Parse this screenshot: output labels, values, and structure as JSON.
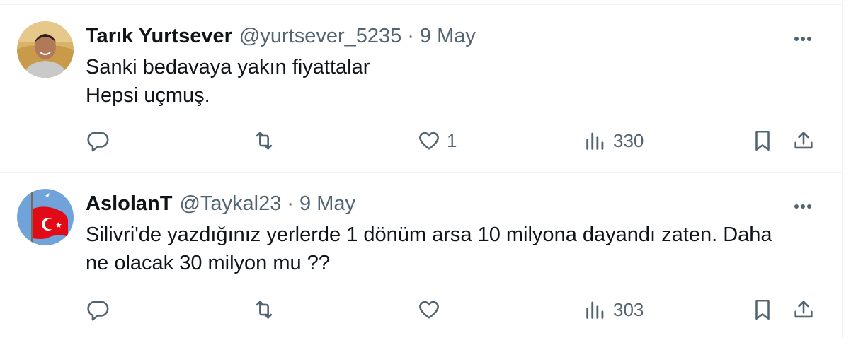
{
  "tweets": [
    {
      "author": {
        "name": "Tarık Yurtsever",
        "handle": "@yurtsever_5235",
        "avatar_icon": "avatar-person-photo"
      },
      "separator": "·",
      "date": "9 May",
      "text_lines": [
        "Sanki bedavaya yakın fiyattalar",
        "Hepsi uçmuş."
      ],
      "stats": {
        "replies": "",
        "retweets": "",
        "likes": "1",
        "views": "330"
      }
    },
    {
      "author": {
        "name": "AslolanT",
        "handle": "@Taykal23",
        "avatar_icon": "avatar-turkish-flag"
      },
      "separator": "·",
      "date": "9 May",
      "text_lines": [
        "Silivri'de yazdığınız yerlerde 1 dönüm arsa 10 milyona dayandı zaten. Daha",
        "ne olacak 30 milyon mu ??"
      ],
      "stats": {
        "replies": "",
        "retweets": "",
        "likes": "",
        "views": "303"
      }
    }
  ],
  "icons": [
    "more-icon",
    "reply-icon",
    "retweet-icon",
    "like-icon",
    "views-icon",
    "bookmark-icon",
    "share-icon"
  ],
  "colors": {
    "text": "#0f1419",
    "secondary": "#536471",
    "border": "#eff3f4",
    "flag_red": "#e30a17",
    "sky": "#6fa3d9"
  }
}
